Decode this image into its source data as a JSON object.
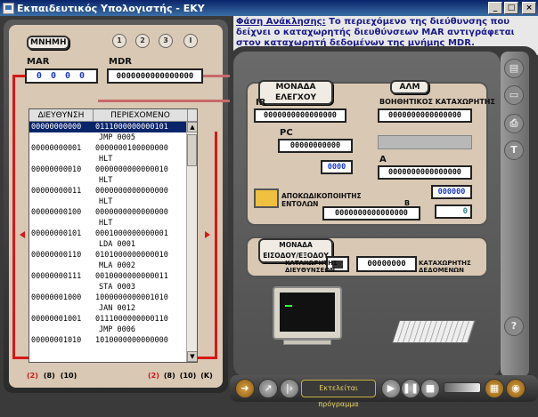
{
  "window": {
    "title": "Εκπαιδευτικός Υπολογιστής - ΕΚΥ",
    "buttons": [
      "_",
      "□",
      "×"
    ]
  },
  "phase": {
    "title": "Φάση Ανάκλησης:",
    "text": "Το περιεχόμενο της διεύθυνσης που δείχνει ο καταχωρητής διευθύνσεων MAR αντιγράφεται στον καταχωρητή δεδομένων της μνήμης MDR."
  },
  "memory": {
    "title": "ΜΝΗΜΗ",
    "steps": [
      "1",
      "2",
      "3",
      "I"
    ],
    "mar_label": "MAR",
    "mar_value": "0 0 0 0",
    "mdr_label": "MDR",
    "mdr_value": "0000000000000000",
    "columns": [
      "ΔΙΕΥΘΥΝΣΗ",
      "ΠΕΡΙΕΧΟΜΕΝΟ"
    ],
    "rows": [
      {
        "addr": "00000000000",
        "val": "0111000000000101",
        "sel": true
      },
      {
        "addr": "",
        "val": "JMP     0005"
      },
      {
        "addr": "00000000001",
        "val": "0000000100000000"
      },
      {
        "addr": "",
        "val": "HLT"
      },
      {
        "addr": "00000000010",
        "val": "0000000000000010"
      },
      {
        "addr": "",
        "val": "HLT"
      },
      {
        "addr": "00000000011",
        "val": "0000000000000000"
      },
      {
        "addr": "",
        "val": "HLT"
      },
      {
        "addr": "00000000100",
        "val": "0000000000000000"
      },
      {
        "addr": "",
        "val": "HLT"
      },
      {
        "addr": "00000000101",
        "val": "0001000000000001"
      },
      {
        "addr": "",
        "val": "LDA     0001"
      },
      {
        "addr": "00000000110",
        "val": "0101000000000010"
      },
      {
        "addr": "",
        "val": "MLA     0002"
      },
      {
        "addr": "00000000111",
        "val": "0010000000000011"
      },
      {
        "addr": "",
        "val": "STA     0003"
      },
      {
        "addr": "00000001000",
        "val": "1000000000001010"
      },
      {
        "addr": "",
        "val": "JAN     0012"
      },
      {
        "addr": "00000001001",
        "val": "0111000000000110"
      },
      {
        "addr": "",
        "val": "JMP     0006"
      },
      {
        "addr": "00000001010",
        "val": "1010000000000000"
      }
    ],
    "base_left": [
      "(2)",
      "(8)",
      "(10)"
    ],
    "base_right": [
      "(2)",
      "(8)",
      "(10)",
      "(K)"
    ]
  },
  "cpu": {
    "control_unit": "ΜΟΝΑΔΑ ΕΛΕΓΧΟΥ",
    "alu": "ΑΛΜ",
    "ir_label": "IR",
    "ir_value": "0000000000000000",
    "pc_label": "PC",
    "pc_value": "00000000000",
    "pc_small": "0000",
    "aux_label": "ΒΟΗΘΗΤΙΚΟΣ ΚΑΤΑΧΩΡΗΤΗΣ",
    "aux_value": "0000000000000000",
    "a_label": "A",
    "a_value": "0000000000000000",
    "a_small": "000000",
    "zero_flag": "0",
    "decoder_label": "ΑΠΟΚΩΔΙΚΟΠΟΙΗΤΗΣ ΕΝΤΟΛΩΝ",
    "b_label": "B",
    "b_value": "0000000000000000"
  },
  "io": {
    "title": "ΜΟΝΑΔΑ ΕΙΣΟΔΟΥ/ΕΞΟΔΟΥ",
    "addr_reg_label": "ΚΑΤΑΧΩΡΗΤΗΣ ΔΙΕΥΘΥΝΣΕΩΝ",
    "data_reg_label": "ΚΑΤΑΧΩΡΗΤΗΣ ΔΕΔΟΜΕΝΩΝ",
    "data_value": "00000000"
  },
  "toolbar": {
    "program_label": "Εκτελείται πρόγραμμα"
  },
  "sidebar": [
    "doc-icon",
    "folder-icon",
    "print-icon",
    "T",
    "?"
  ]
}
